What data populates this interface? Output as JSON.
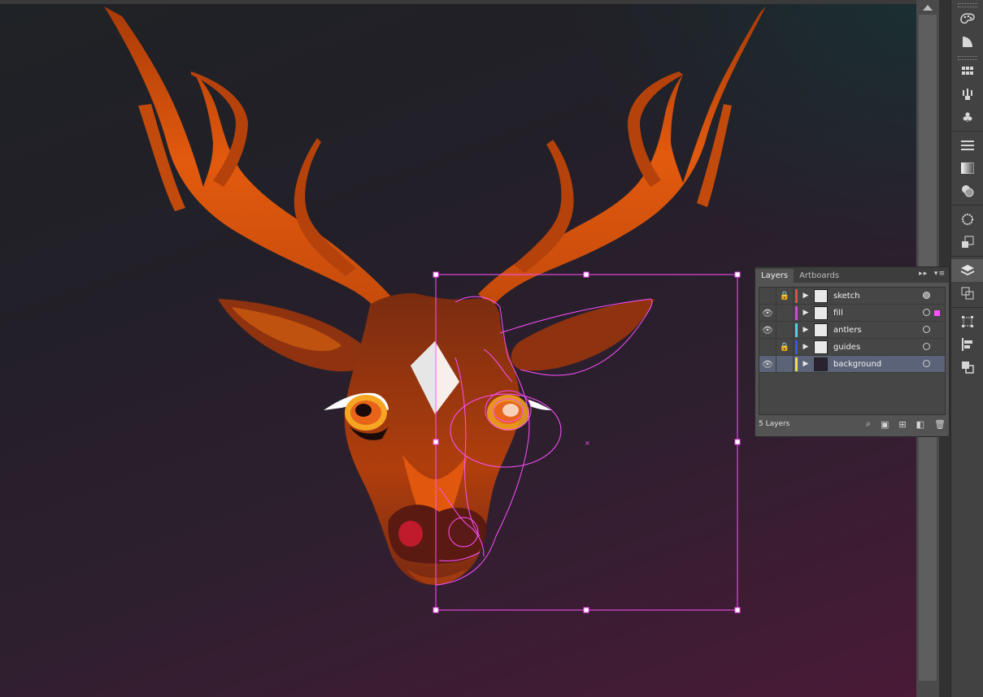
{
  "panel": {
    "tabs": [
      "Layers",
      "Artboards"
    ],
    "layer_count_label": "5 Layers",
    "layers": [
      {
        "name": "sketch",
        "visible": false,
        "locked": true,
        "color": "#e24b4b",
        "targeted": true,
        "selected": false
      },
      {
        "name": "fill",
        "visible": true,
        "locked": false,
        "color": "#d14ad6",
        "targeted": false,
        "selected": false,
        "has_selection": true
      },
      {
        "name": "antlers",
        "visible": true,
        "locked": false,
        "color": "#4fd2e0",
        "targeted": false,
        "selected": false
      },
      {
        "name": "guides",
        "visible": false,
        "locked": true,
        "color": "#3d55e0",
        "targeted": false,
        "selected": false
      },
      {
        "name": "background",
        "visible": true,
        "locked": false,
        "color": "#e8df4a",
        "targeted": false,
        "selected": true
      }
    ],
    "icons": [
      "search-icon",
      "clipping-mask-icon",
      "new-sublayer-icon",
      "new-layer-icon",
      "trash-icon"
    ]
  },
  "dock": {
    "icons": [
      "color-icon",
      "color-guide-icon",
      "swatches-icon",
      "brushes-icon",
      "symbols-icon",
      "stroke-icon",
      "gradient-icon",
      "transparency-icon",
      "appearance-icon",
      "graphic-styles-icon",
      "layers-icon",
      "artboards-icon",
      "transform-icon",
      "align-icon",
      "pathfinder-icon"
    ]
  },
  "colors": {
    "canvas_top": "#1f2226",
    "canvas_bottom": "#4a1a37",
    "antler_orange": "#e0580e",
    "selection_magenta": "#ff4fff"
  }
}
